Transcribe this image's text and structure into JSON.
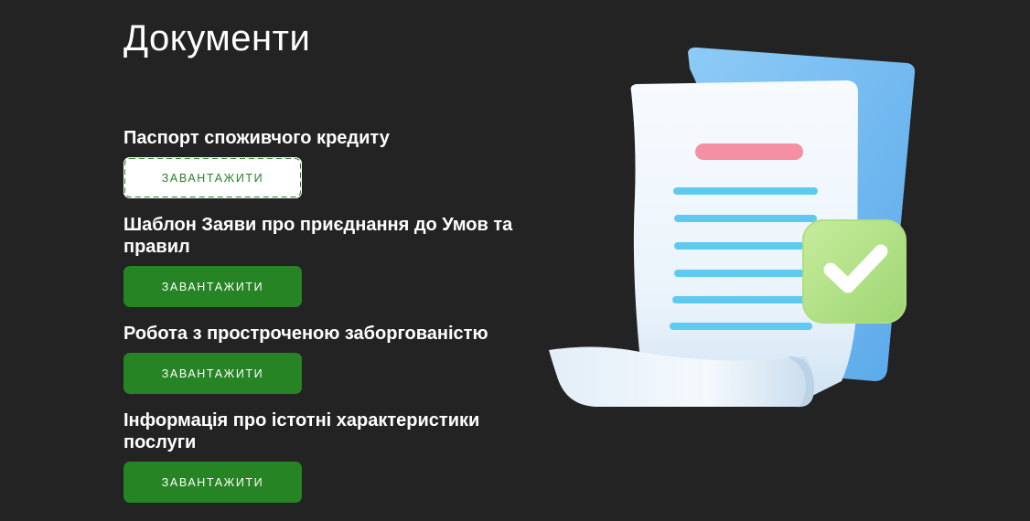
{
  "page": {
    "title": "Документи"
  },
  "documents": [
    {
      "title": "Паспорт споживчого кредиту",
      "button_label": "ЗАВАНТАЖИТИ",
      "focused": true
    },
    {
      "title": "Шаблон Заяви про приєднання до Умов та правил",
      "button_label": "ЗАВАНТАЖИТИ",
      "focused": false
    },
    {
      "title": "Робота з простроченою заборгованістю",
      "button_label": "ЗАВАНТАЖИТИ",
      "focused": false
    },
    {
      "title": "Інформація про істотні характеристики послуги",
      "button_label": "ЗАВАНТАЖИТИ",
      "focused": false
    }
  ],
  "colors": {
    "background": "#232323",
    "button": "#268425",
    "button_text": "#ffffff",
    "paper": "#eef6fc",
    "paper_back": "#7cc0f2",
    "text_lines": "#5fcaf0",
    "heading_line": "#f58fa3",
    "check_badge": "#b5e38a"
  },
  "illustration": {
    "icon": "document-check-icon"
  }
}
